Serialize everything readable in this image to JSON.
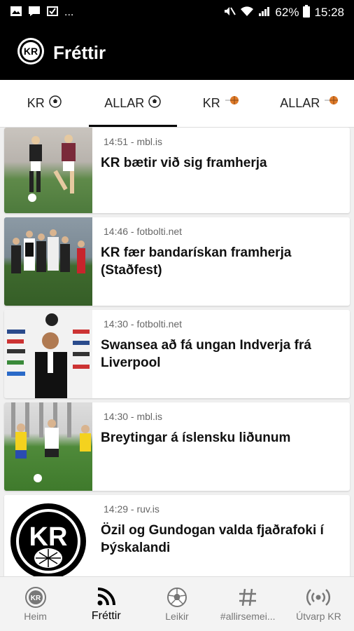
{
  "status": {
    "battery": "62%",
    "time": "15:28",
    "more": "..."
  },
  "app": {
    "title": "Fréttir"
  },
  "tabs": [
    {
      "label": "KR",
      "icon": "soccer-ball-icon"
    },
    {
      "label": "ALLAR",
      "icon": "soccer-ball-icon"
    },
    {
      "label": "KR",
      "icon": "basketball-icon"
    },
    {
      "label": "ALLAR",
      "icon": "basketball-icon"
    }
  ],
  "articles": [
    {
      "meta": "14:51 - mbl.is",
      "headline": "KR bætir við sig framherja"
    },
    {
      "meta": "14:46 - fotbolti.net",
      "headline": "KR fær bandarískan framherja (Staðfest)"
    },
    {
      "meta": "14:30 - fotbolti.net",
      "headline": "Swansea að fá ungan Indverja frá Liverpool"
    },
    {
      "meta": "14:30 - mbl.is",
      "headline": "Breytingar á íslensku liðunum"
    },
    {
      "meta": "14:29 - ruv.is",
      "headline": "Özil og Gundogan valda fjaðrafoki í Þýskalandi"
    }
  ],
  "nav": [
    {
      "label": "Heim",
      "icon": "kr-logo-icon"
    },
    {
      "label": "Fréttir",
      "icon": "rss-icon"
    },
    {
      "label": "Leikir",
      "icon": "soccer-ball-icon"
    },
    {
      "label": "#allirsemei...",
      "icon": "hashtag-icon"
    },
    {
      "label": "Útvarp KR",
      "icon": "radio-broadcast-icon"
    }
  ],
  "logo_text": "KR",
  "colors": {
    "bar": "#000000",
    "active": "#000000",
    "inactive": "#777777"
  }
}
